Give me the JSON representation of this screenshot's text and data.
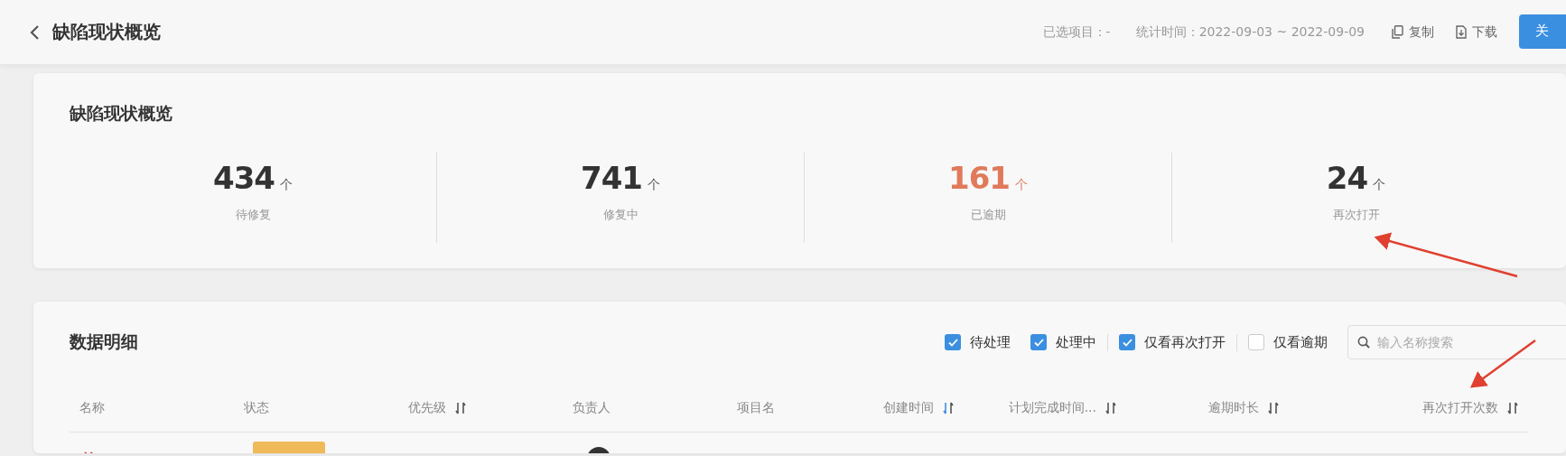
{
  "header": {
    "title": "缺陷现状概览",
    "selected_projects": "已选项目：-",
    "period": "统计时间：2022-09-03 ~ 2022-09-09",
    "actions": [
      {
        "kind": "copy",
        "label": "复制"
      },
      {
        "kind": "download",
        "label": "下载"
      }
    ],
    "close_button": "关"
  },
  "overview": {
    "title": "缺陷现状概览",
    "stats": [
      {
        "value": "434",
        "unit": "个",
        "label": "待修复",
        "highlight": false
      },
      {
        "value": "741",
        "unit": "个",
        "label": "修复中",
        "highlight": false
      },
      {
        "value": "161",
        "unit": "个",
        "label": "已逾期",
        "highlight": true
      },
      {
        "value": "24",
        "unit": "个",
        "label": "再次打开",
        "highlight": false
      }
    ]
  },
  "details": {
    "title": "数据明细",
    "filters": [
      {
        "label": "待处理",
        "checked": true,
        "divider_after": false
      },
      {
        "label": "处理中",
        "checked": true,
        "divider_after": true
      },
      {
        "label": "仅看再次打开",
        "checked": true,
        "divider_after": true
      },
      {
        "label": "仅看逾期",
        "checked": false,
        "divider_after": false
      }
    ],
    "search": {
      "placeholder": "输入名称搜索"
    },
    "columns": [
      {
        "label": "名称",
        "sortable": false
      },
      {
        "label": "状态",
        "sortable": false
      },
      {
        "label": "优先级",
        "sortable": true,
        "sort_active": false
      },
      {
        "label": "负责人",
        "sortable": false
      },
      {
        "label": "项目名",
        "sortable": false
      },
      {
        "label": "创建时间",
        "sortable": true,
        "sort_active": true
      },
      {
        "label": "计划完成时间...",
        "sortable": true,
        "sort_active": false
      },
      {
        "label": "逾期时长",
        "sortable": true,
        "sort_active": false
      },
      {
        "label": "再次打开次数",
        "sortable": true,
        "sort_active": false
      }
    ]
  }
}
